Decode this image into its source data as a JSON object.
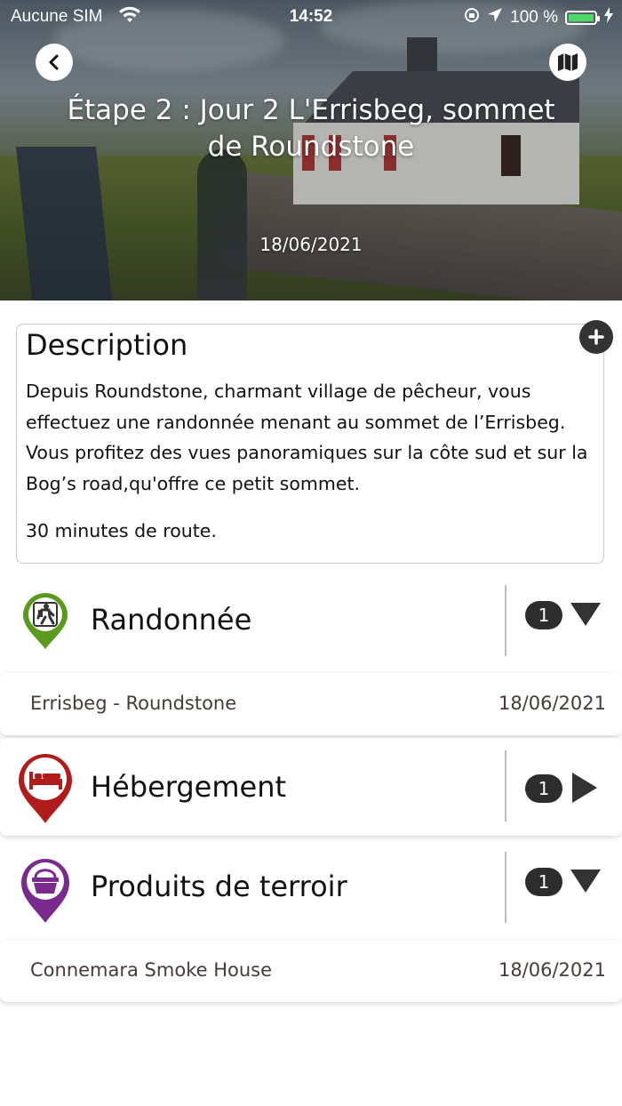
{
  "status_bar": {
    "carrier": "Aucune SIM",
    "time": "14:52",
    "battery": "100 %",
    "battery_color": "#4cd964"
  },
  "header": {
    "title": "Étape 2 : Jour 2 L'Errisbeg, sommet de Roundstone",
    "date": "18/06/2021",
    "back_icon": "chevron-left-icon",
    "map_icon": "map-icon"
  },
  "description": {
    "title": "Description",
    "text": "Depuis Roundstone, charmant village de pêcheur, vous effectuez une randonnée menant au sommet de l’Errisbeg. Vous profitez des vues panoramiques sur la côte sud et sur la Bog’s road,qu'offre ce petit sommet.",
    "extra": "30 minutes de route.",
    "expand_icon": "plus-icon"
  },
  "categories": [
    {
      "label": "Randonnée",
      "count": "1",
      "color": "#5b9a1c",
      "icon": "hiker-icon",
      "state": "expanded",
      "items": [
        {
          "name": "Errisbeg - Roundstone",
          "date": "18/06/2021"
        }
      ]
    },
    {
      "label": "Hébergement",
      "count": "1",
      "color": "#b01c1c",
      "icon": "bed-icon",
      "state": "collapsed",
      "items": []
    },
    {
      "label": "Produits de terroir",
      "count": "1",
      "color": "#7a2a8c",
      "icon": "basket-icon",
      "state": "expanded",
      "items": [
        {
          "name": "Connemara Smoke House",
          "date": "18/06/2021"
        }
      ]
    }
  ]
}
